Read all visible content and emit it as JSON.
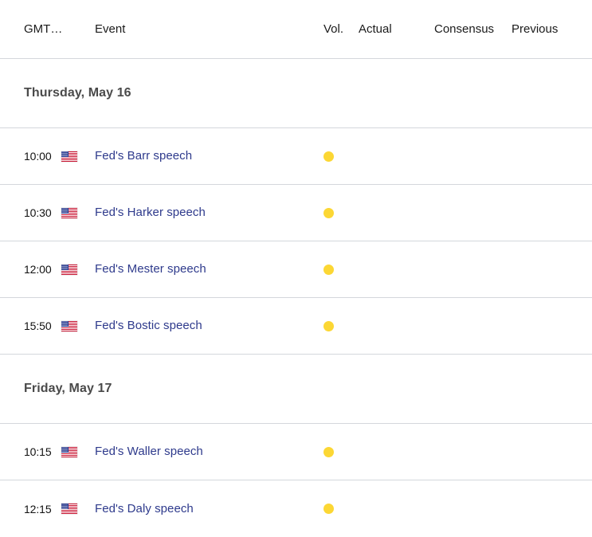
{
  "header": {
    "time": "GMT…",
    "event": "Event",
    "vol": "Vol.",
    "actual": "Actual",
    "consensus": "Consensus",
    "previous": "Previous"
  },
  "colors": {
    "link": "#2e3a8c",
    "divider": "#d4d7dc",
    "volatility_medium": "#fcd734",
    "day_title": "#4a4a4a",
    "background": "#ffffff"
  },
  "groups": [
    {
      "date": "Thursday, May 16",
      "events": [
        {
          "time": "10:00",
          "flag": "us-flag-icon",
          "name": "Fed's Barr speech",
          "volatility": "medium-volatility-icon",
          "actual": "",
          "consensus": "",
          "previous": ""
        },
        {
          "time": "10:30",
          "flag": "us-flag-icon",
          "name": "Fed's Harker speech",
          "volatility": "medium-volatility-icon",
          "actual": "",
          "consensus": "",
          "previous": ""
        },
        {
          "time": "12:00",
          "flag": "us-flag-icon",
          "name": "Fed's Mester speech",
          "volatility": "medium-volatility-icon",
          "actual": "",
          "consensus": "",
          "previous": ""
        },
        {
          "time": "15:50",
          "flag": "us-flag-icon",
          "name": "Fed's Bostic speech",
          "volatility": "medium-volatility-icon",
          "actual": "",
          "consensus": "",
          "previous": ""
        }
      ]
    },
    {
      "date": "Friday, May 17",
      "events": [
        {
          "time": "10:15",
          "flag": "us-flag-icon",
          "name": "Fed's Waller speech",
          "volatility": "medium-volatility-icon",
          "actual": "",
          "consensus": "",
          "previous": ""
        },
        {
          "time": "12:15",
          "flag": "us-flag-icon",
          "name": "Fed's Daly speech",
          "volatility": "medium-volatility-icon",
          "actual": "",
          "consensus": "",
          "previous": ""
        }
      ]
    }
  ]
}
